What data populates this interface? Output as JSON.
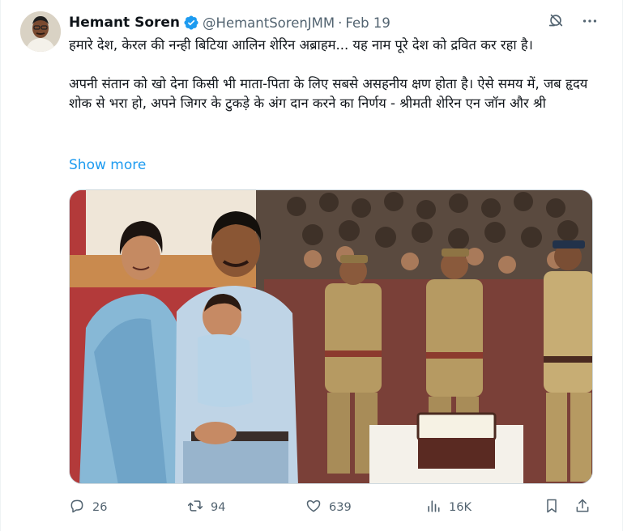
{
  "author": {
    "name": "Hemant Soren",
    "handle": "@HemantSorenJMM",
    "separator": "·",
    "date": "Feb 19"
  },
  "tweet": {
    "paragraph1": "हमारे देश, केरल की नन्ही बिटिया आलिन शेरिन अब्राहम... यह नाम पूरे देश को द्रवित कर रहा है।",
    "paragraph2": "अपनी संतान को खो देना किसी भी माता-पिता के लिए सबसे असहनीय क्षण होता है। ऐसे समय में, जब हृदय शोक से भरा हो, अपने जिगर के टुकड़े के अंग दान करने का निर्णय - श्रीमती शेरिन एन जॉन और श्री",
    "show_more": "Show more"
  },
  "stats": {
    "replies": "26",
    "reposts": "94",
    "likes": "639",
    "views": "16K"
  },
  "icons": {
    "verified": "verified-badge-icon",
    "grok": "grok-icon",
    "more": "more-icon",
    "reply": "reply-icon",
    "repost": "repost-icon",
    "like": "heart-icon",
    "views": "views-icon",
    "bookmark": "bookmark-icon",
    "share": "share-icon"
  },
  "colors": {
    "accent": "#1d9bf0",
    "text": "#0f1419",
    "secondary": "#536471",
    "border": "#cfd9de"
  }
}
